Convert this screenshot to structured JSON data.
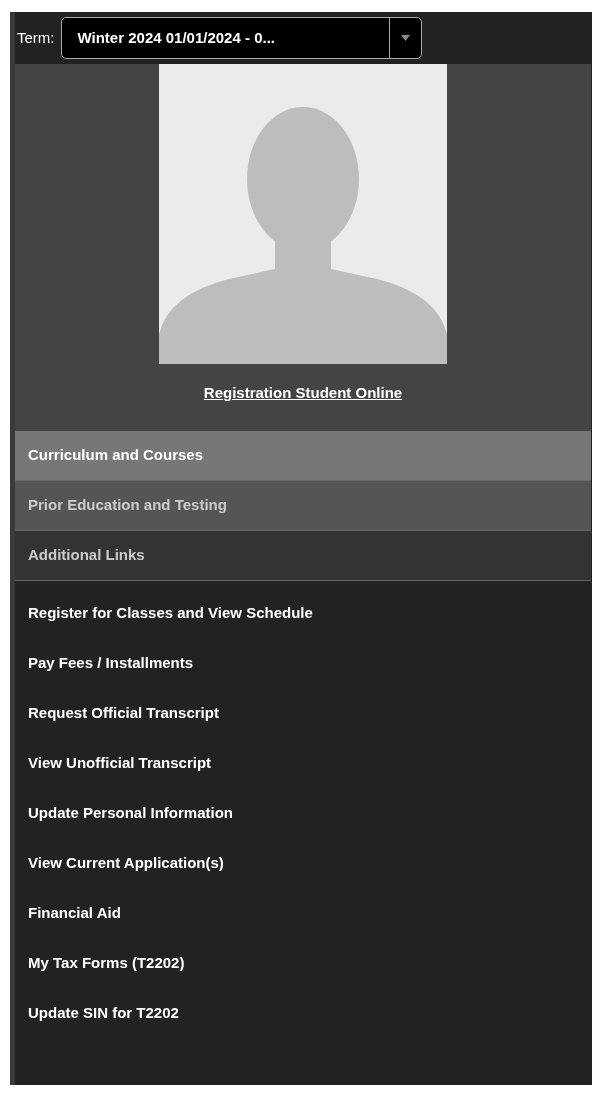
{
  "term": {
    "label": "Term:",
    "value": "Winter 2024 01/01/2024 - 0..."
  },
  "profile": {
    "name": "Registration Student Online"
  },
  "sections": [
    {
      "label": "Curriculum and Courses",
      "selected": true,
      "color": "#777777"
    },
    {
      "label": "Prior Education and Testing",
      "selected": false,
      "color": "#555555"
    },
    {
      "label": "Additional Links",
      "selected": false,
      "color": "#333333"
    }
  ],
  "links": [
    "Register for Classes and View Schedule",
    "Pay Fees / Installments",
    "Request Official Transcript",
    "View Unofficial Transcript",
    "Update Personal Information",
    "View Current Application(s)",
    "Financial Aid",
    "My Tax Forms (T2202)",
    "Update SIN for T2202"
  ]
}
